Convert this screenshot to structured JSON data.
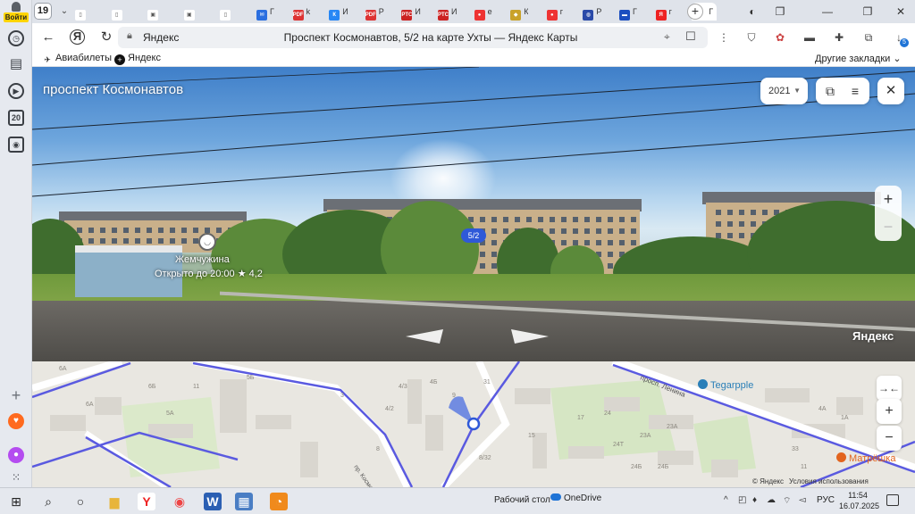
{
  "sidebar": {
    "login_label": "Войти",
    "counter_box": "20"
  },
  "tabs": {
    "counter": "19",
    "items": [
      {
        "label": "",
        "icon": "page-icon"
      },
      {
        "label": "",
        "icon": "page-icon"
      },
      {
        "label": "",
        "icon": "image-icon"
      },
      {
        "label": "",
        "icon": "image-icon"
      },
      {
        "label": "",
        "icon": "page-icon"
      },
      {
        "label": "Г",
        "icon": "mail-icon"
      },
      {
        "label": "k",
        "icon": "pdf-icon"
      },
      {
        "label": "И",
        "icon": "vk-icon"
      },
      {
        "label": "Р",
        "icon": "pdf-icon"
      },
      {
        "label": "И",
        "icon": "rts-icon"
      },
      {
        "label": "И",
        "icon": "rts-icon"
      },
      {
        "label": "е",
        "icon": "red-icon"
      },
      {
        "label": "К",
        "icon": "coat-icon"
      },
      {
        "label": "г",
        "icon": "red-icon"
      },
      {
        "label": "Р",
        "icon": "globe-icon"
      },
      {
        "label": "Г",
        "icon": "flag-icon"
      },
      {
        "label": "г",
        "icon": "yandex-icon"
      },
      {
        "label": "Г",
        "icon": "maps-pin-icon",
        "active": true
      }
    ]
  },
  "addressbar": {
    "domain": "Яндекс",
    "page_title": "Проспект Космонавтов, 5/2 на карте Ухты — Яндекс Карты"
  },
  "downloads_badge": "5",
  "bookmarks": {
    "items": [
      "Авиабилеты",
      "Яндекс"
    ],
    "other": "Другие закладки"
  },
  "panorama": {
    "street_title": "проспект Космонавтов",
    "year": "2021",
    "house_badge": "5/2",
    "poi_name": "Жемчужина",
    "poi_hours": "Открыто до 20:00",
    "poi_rating": "★ 4,2",
    "brand": "Яндекс"
  },
  "map": {
    "poi_tegarpple": "Tegarpple",
    "poi_matreshka": "Матрёшка",
    "street_lenina": "просп. Ленина",
    "street_kosmonavtov": "пр. Космонавтов",
    "copyright": "© Яндекс",
    "terms": "Условия использования",
    "labels": [
      {
        "t": "6А"
      },
      {
        "t": "6Б"
      },
      {
        "t": "5Б"
      },
      {
        "t": "4/3"
      },
      {
        "t": "4Б"
      },
      {
        "t": "4/2"
      },
      {
        "t": "6А"
      },
      {
        "t": "5А"
      },
      {
        "t": "3"
      },
      {
        "t": "11"
      },
      {
        "t": "8"
      },
      {
        "t": "9"
      },
      {
        "t": "15"
      },
      {
        "t": "17"
      },
      {
        "t": "24"
      },
      {
        "t": "23А"
      },
      {
        "t": "8/32"
      },
      {
        "t": "24Т"
      },
      {
        "t": "23А"
      },
      {
        "t": "24Б"
      },
      {
        "t": "24Б"
      },
      {
        "t": "31"
      },
      {
        "t": "33"
      },
      {
        "t": "1А"
      },
      {
        "t": "4А"
      },
      {
        "t": "11"
      }
    ]
  },
  "taskbar": {
    "desktop": "Рабочий стол",
    "onedrive": "OneDrive",
    "lang": "РУС",
    "time": "11:54",
    "date": "16.07.2025"
  }
}
